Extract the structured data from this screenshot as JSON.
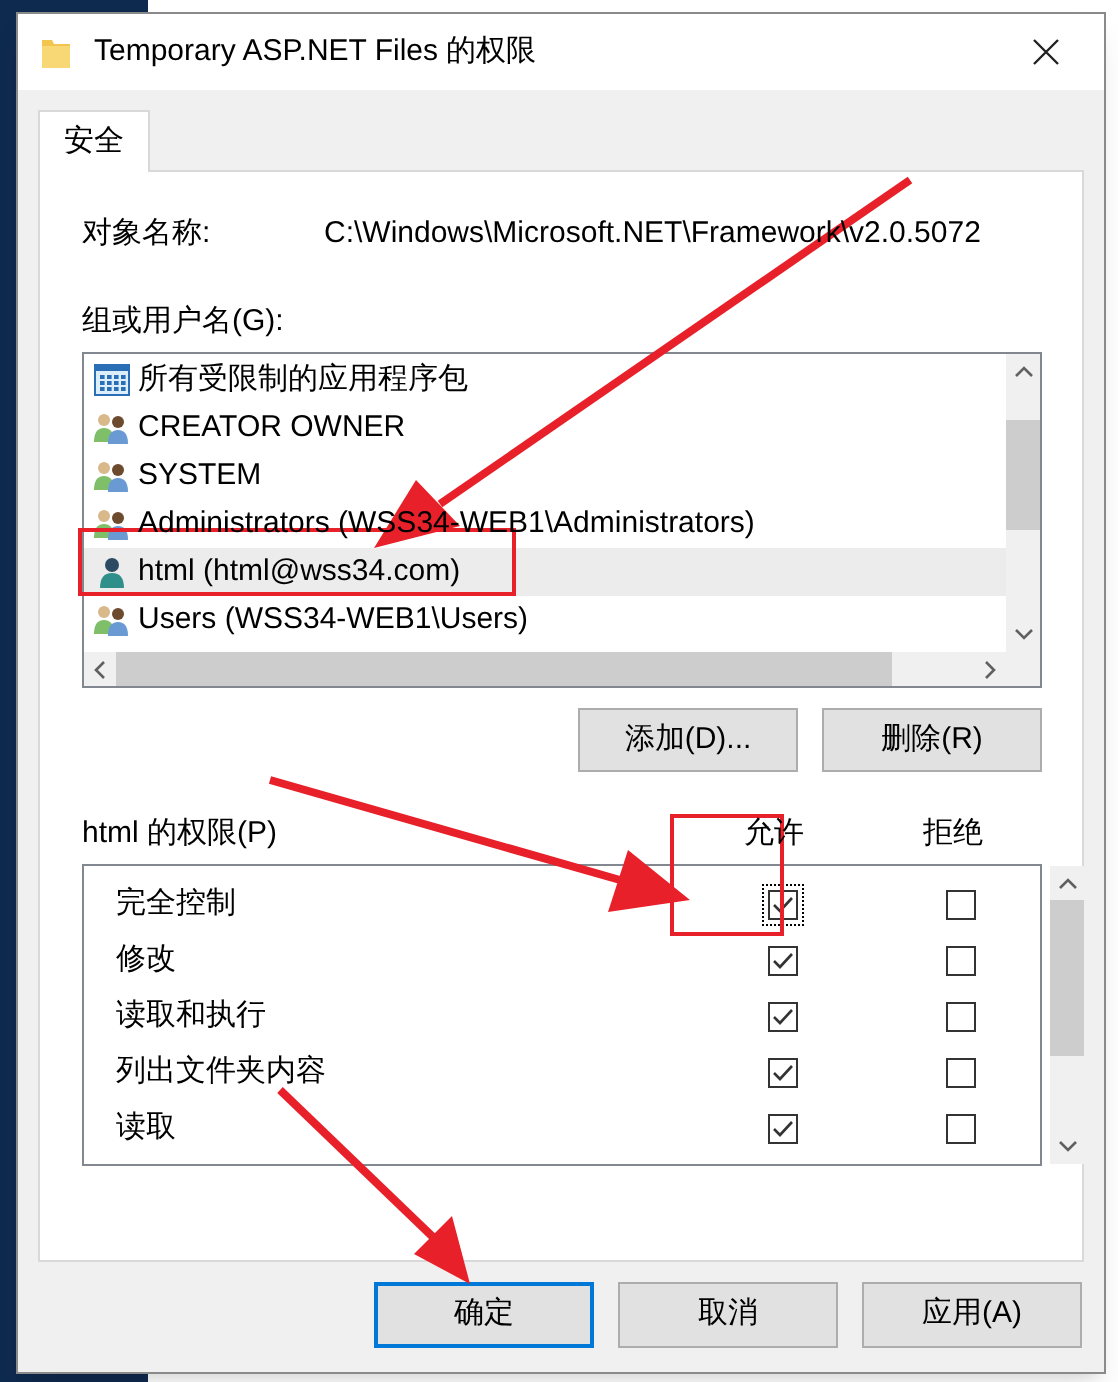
{
  "window": {
    "title": "Temporary ASP.NET Files 的权限"
  },
  "tabs": [
    {
      "label": "安全",
      "selected": true
    }
  ],
  "object_name": {
    "label": "对象名称:",
    "value": "C:\\Windows\\Microsoft.NET\\Framework\\v2.0.5072"
  },
  "users": {
    "label": "组或用户名(G):",
    "items": [
      {
        "name": "所有受限制的应用程序包",
        "kind": "package",
        "selected": false
      },
      {
        "name": "CREATOR OWNER",
        "kind": "group",
        "selected": false
      },
      {
        "name": "SYSTEM",
        "kind": "group",
        "selected": false
      },
      {
        "name": "Administrators (WSS34-WEB1\\Administrators)",
        "kind": "group",
        "selected": false
      },
      {
        "name": "html (html@wss34.com)",
        "kind": "user",
        "selected": true
      },
      {
        "name": "Users (WSS34-WEB1\\Users)",
        "kind": "group",
        "selected": false
      }
    ]
  },
  "user_buttons": [
    "添加(D)...",
    "删除(R)"
  ],
  "permissions": {
    "label": "html 的权限(P)",
    "columns": [
      "允许",
      "拒绝"
    ],
    "rows": [
      {
        "name": "完全控制",
        "allow": true,
        "deny": false,
        "focused": true
      },
      {
        "name": "修改",
        "allow": true,
        "deny": false,
        "focused": false
      },
      {
        "name": "读取和执行",
        "allow": true,
        "deny": false,
        "focused": false
      },
      {
        "name": "列出文件夹内容",
        "allow": true,
        "deny": false,
        "focused": false
      },
      {
        "name": "读取",
        "allow": true,
        "deny": false,
        "focused": false
      }
    ]
  },
  "dialog_buttons": [
    {
      "label": "确定",
      "default": true
    },
    {
      "label": "取消",
      "default": false
    },
    {
      "label": "应用(A)",
      "default": false
    }
  ]
}
